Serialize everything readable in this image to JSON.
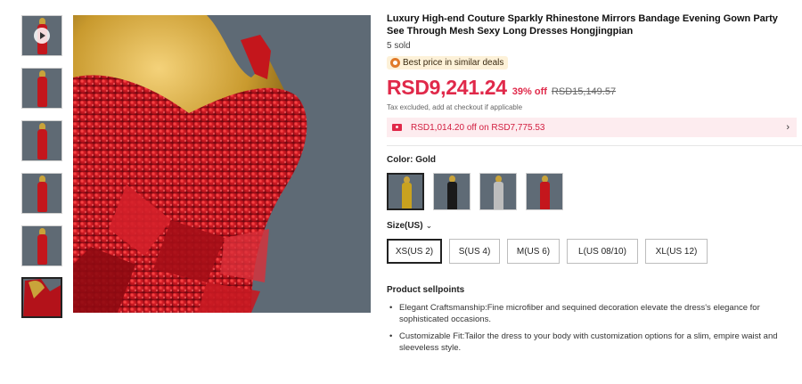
{
  "gallery": {
    "thumbnails": [
      {
        "name": "thumb-video",
        "has_play_icon": true
      },
      {
        "name": "thumb-2"
      },
      {
        "name": "thumb-3"
      },
      {
        "name": "thumb-4"
      },
      {
        "name": "thumb-5"
      },
      {
        "name": "thumb-6",
        "selected": true
      }
    ],
    "main_image_colors": {
      "background": "#5e6a75",
      "dress": "#c4161c",
      "mannequin": "#c9a33a"
    }
  },
  "product": {
    "title": "Luxury High-end Couture Sparkly Rhinestone Mirrors Bandage Evening Gown Party See Through Mesh Sexy Long Dresses Hongjingpian",
    "sold": "5 sold",
    "best_price_badge": "Best price in similar deals",
    "price": "RSD9,241.24",
    "discount": "39% off",
    "original_price": "RSD15,149.57",
    "tax_note": "Tax excluded, add at checkout if applicable",
    "coupon": "RSD1,014.20 off on RSD7,775.53",
    "color_label": "Color: Gold",
    "color_swatches": [
      {
        "name": "gold",
        "dress_color": "#c9a21f",
        "selected": true
      },
      {
        "name": "black",
        "dress_color": "#1a1a1a"
      },
      {
        "name": "silver",
        "dress_color": "#bdbdbd"
      },
      {
        "name": "red",
        "dress_color": "#c4161c"
      }
    ],
    "size_label": "Size(US)",
    "sizes": [
      "XS(US 2)",
      "S(US 4)",
      "M(US 6)",
      "L(US 08/10)",
      "XL(US 12)"
    ],
    "selected_size": "XS(US 2)",
    "sellpoints_title": "Product sellpoints",
    "sellpoints": [
      "Elegant Craftsmanship:Fine microfiber and sequined decoration elevate the dress's elegance for sophisticated occasions.",
      "Customizable Fit:Tailor the dress to your body with customization options for a slim, empire waist and sleeveless style."
    ]
  },
  "colors": {
    "accent": "#e0294a",
    "coupon_bg": "#fdecef",
    "badge_bg": "#fdf1d8"
  }
}
